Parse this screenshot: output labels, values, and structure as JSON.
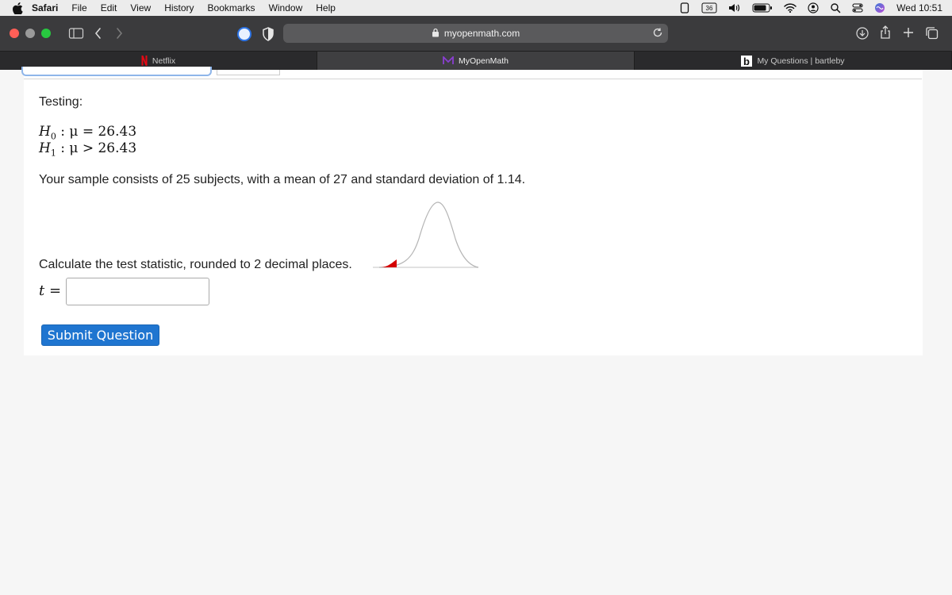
{
  "menubar": {
    "app": "Safari",
    "items": [
      "File",
      "Edit",
      "View",
      "History",
      "Bookmarks",
      "Window",
      "Help"
    ],
    "battery_badge": "36",
    "clock": "Wed 10:51"
  },
  "toolbar": {
    "url": "myopenmath.com"
  },
  "tabs": [
    {
      "label": "Netflix",
      "icon": "netflix-icon",
      "active": false
    },
    {
      "label": "MyOpenMath",
      "icon": "myopenmath-icon",
      "active": true
    },
    {
      "label": "My Questions | bartleby",
      "icon": "bartleby-icon",
      "active": false
    }
  ],
  "question": {
    "heading": "Testing:",
    "h0": {
      "symbol": "H",
      "sub": "0",
      "relation": "μ = 26.43"
    },
    "h1": {
      "symbol": "H",
      "sub": "1",
      "relation": "μ > 26.43"
    },
    "sample_text": "Your sample consists of 25 subjects, with a mean of 27 and standard deviation of 1.14.",
    "prompt": "Calculate the test statistic, rounded to 2 decimal places.",
    "var_label": "t",
    "equals": "=",
    "answer_value": "",
    "submit_label": "Submit Question"
  },
  "colors": {
    "accent": "#1f75d0",
    "shaded_tail": "#d40000"
  }
}
